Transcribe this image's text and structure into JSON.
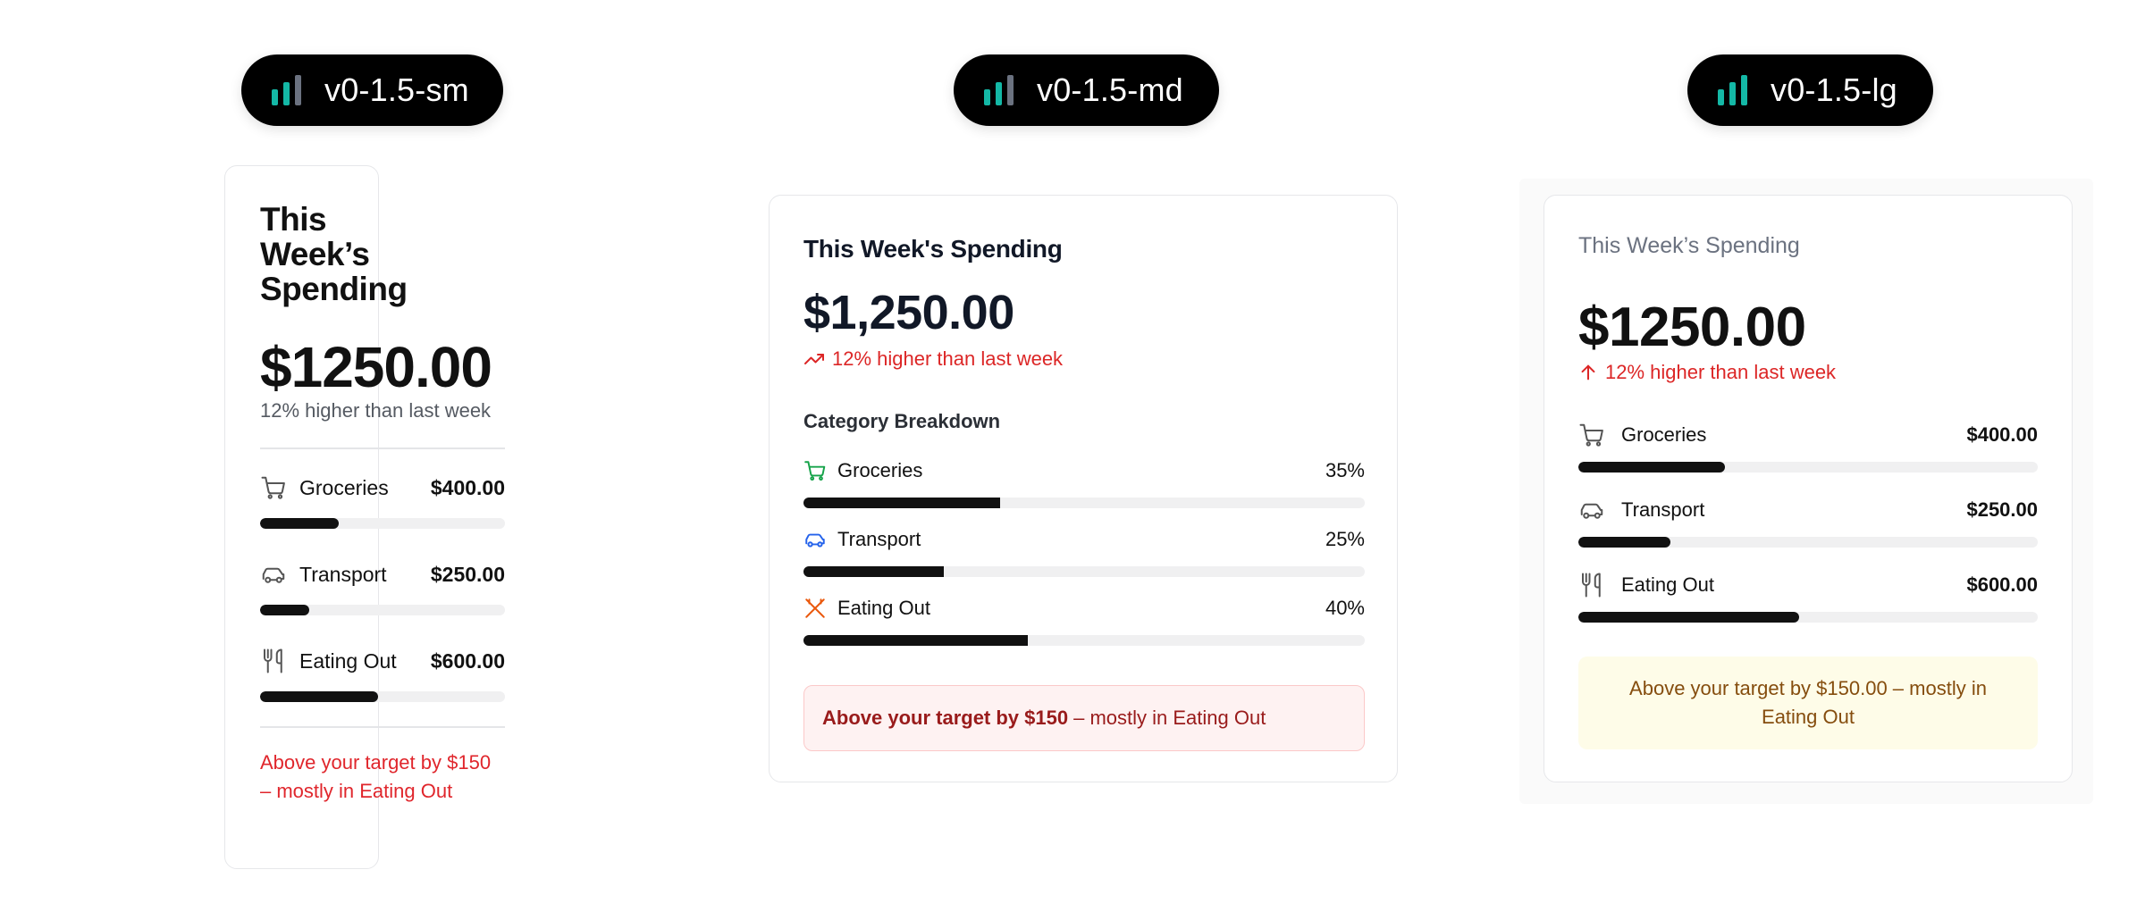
{
  "colors": {
    "pill_bg": "#000000",
    "pill_bar_teal": "#14b8a6",
    "pill_bar_gray": "#6b7280",
    "progress_fill": "#111111",
    "progress_track": "#f0f0f1",
    "alert_red": "#dc2626",
    "alert_yellow_bg": "#fefce8",
    "alert_red_bg": "#fef2f2"
  },
  "models": [
    {
      "label": "v0-1.5-sm",
      "icon": "signal-bars-icon"
    },
    {
      "label": "v0-1.5-md",
      "icon": "signal-bars-icon"
    },
    {
      "label": "v0-1.5-lg",
      "icon": "signal-bars-icon"
    }
  ],
  "sm": {
    "title": "This Week’s Spending",
    "total": "$1250.00",
    "sub": "12% higher than last week",
    "categories": [
      {
        "name": "Groceries",
        "amount": "$400.00",
        "icon": "shopping-cart-icon",
        "progress": 0.32
      },
      {
        "name": "Transport",
        "amount": "$250.00",
        "icon": "car-icon",
        "progress": 0.2
      },
      {
        "name": "Eating Out",
        "amount": "$600.00",
        "icon": "utensils-icon",
        "progress": 0.48
      }
    ],
    "alert": "Above your target by $150 – mostly in Eating Out"
  },
  "md": {
    "title": "This Week's Spending",
    "total": "$1,250.00",
    "trend": "12% higher than last week",
    "section": "Category Breakdown",
    "categories": [
      {
        "name": "Groceries",
        "pct": "35%",
        "icon": "shopping-cart-icon",
        "progress": 0.35
      },
      {
        "name": "Transport",
        "pct": "25%",
        "icon": "car-icon",
        "progress": 0.25
      },
      {
        "name": "Eating Out",
        "pct": "40%",
        "icon": "utensils-crossed-icon",
        "progress": 0.4
      }
    ],
    "alert_bold": "Above your target by $150",
    "alert_rest": "– mostly in Eating Out"
  },
  "lg": {
    "title": "This Week’s Spending",
    "total": "$1250.00",
    "trend": "12% higher than last week",
    "categories": [
      {
        "name": "Groceries",
        "amount": "$400.00",
        "icon": "shopping-cart-icon",
        "progress": 0.32
      },
      {
        "name": "Transport",
        "amount": "$250.00",
        "icon": "car-icon",
        "progress": 0.2
      },
      {
        "name": "Eating Out",
        "amount": "$600.00",
        "icon": "utensils-icon",
        "progress": 0.48
      }
    ],
    "alert": "Above your target by $150.00 – mostly in Eating Out"
  }
}
